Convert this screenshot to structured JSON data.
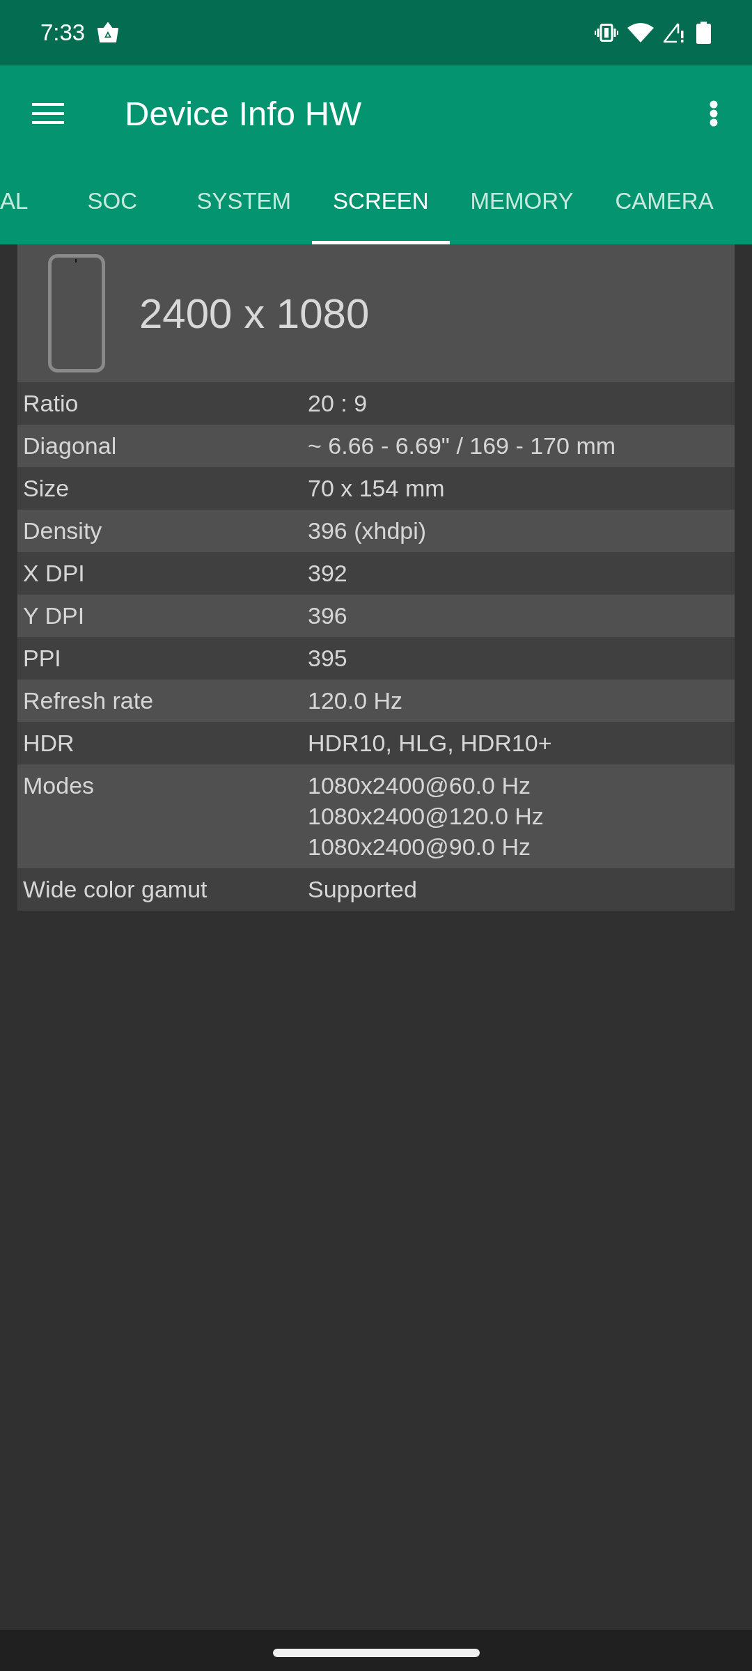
{
  "status_bar": {
    "time": "7:33"
  },
  "app_bar": {
    "title": "Device Info HW"
  },
  "tabs": [
    {
      "label": "AL",
      "selected": false
    },
    {
      "label": "SOC",
      "selected": false
    },
    {
      "label": "SYSTEM",
      "selected": false
    },
    {
      "label": "SCREEN",
      "selected": true
    },
    {
      "label": "MEMORY",
      "selected": false
    },
    {
      "label": "CAMERA",
      "selected": false
    }
  ],
  "screen_card": {
    "resolution": "2400 x 1080"
  },
  "rows": [
    {
      "label": "Ratio",
      "values": [
        "20 : 9"
      ]
    },
    {
      "label": "Diagonal",
      "values": [
        "~ 6.66 - 6.69\" / 169 - 170 mm"
      ]
    },
    {
      "label": "Size",
      "values": [
        "70 x 154 mm"
      ]
    },
    {
      "label": "Density",
      "values": [
        "396 (xhdpi)"
      ]
    },
    {
      "label": "X DPI",
      "values": [
        "392"
      ]
    },
    {
      "label": "Y DPI",
      "values": [
        "396"
      ]
    },
    {
      "label": "PPI",
      "values": [
        "395"
      ]
    },
    {
      "label": "Refresh rate",
      "values": [
        "120.0 Hz"
      ]
    },
    {
      "label": "HDR",
      "values": [
        "HDR10, HLG, HDR10+"
      ]
    },
    {
      "label": "Modes",
      "values": [
        "1080x2400@60.0 Hz",
        "1080x2400@120.0 Hz",
        "1080x2400@90.0 Hz"
      ]
    },
    {
      "label": "Wide color gamut",
      "values": [
        "Supported"
      ]
    }
  ]
}
